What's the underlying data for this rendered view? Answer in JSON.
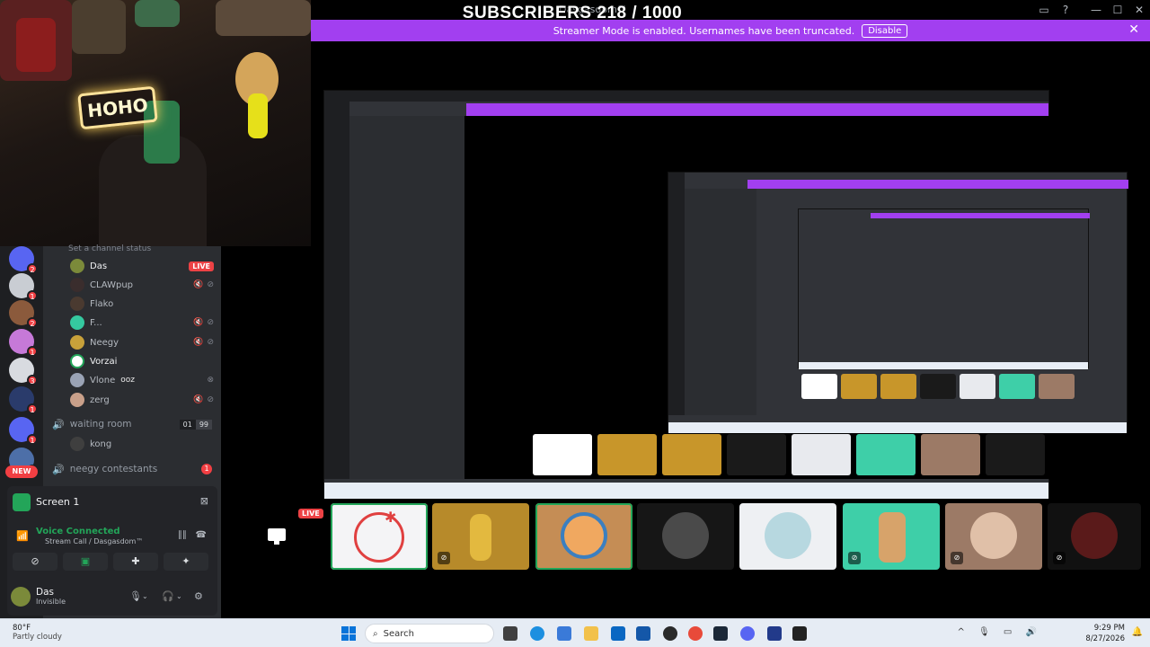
{
  "overlay": {
    "subscriber_counter": "SUBSCRIBERS 218 / 1000"
  },
  "window": {
    "title": "Dasgasdom™"
  },
  "streamer_banner": {
    "text": "Streamer Mode is enabled. Usernames have been truncated.",
    "button": "Disable"
  },
  "webcam": {
    "neon_text": "HOHO"
  },
  "sidebar": {
    "new_label": "NEW",
    "channel_status_hint": "Set a channel status",
    "server_badges": [
      "2",
      "1",
      "2",
      "1",
      "3",
      "1",
      "1",
      "1"
    ],
    "voice_users": [
      {
        "name": "Das",
        "badge": "LIVE"
      },
      {
        "name": "CLAWpup",
        "badge": ""
      },
      {
        "name": "Flako",
        "badge": ""
      },
      {
        "name": "F...",
        "badge": ""
      },
      {
        "name": "Neegy",
        "badge": ""
      },
      {
        "name": "Vorzai",
        "badge": ""
      },
      {
        "name": "Vlone",
        "badge": "ooz"
      },
      {
        "name": "zerg",
        "badge": ""
      }
    ],
    "waiting_room": {
      "name": "waiting room",
      "count": "01",
      "limit": "99",
      "member": "kong"
    },
    "neegy_contestants": {
      "name": "neegy contestants",
      "unread": "1"
    }
  },
  "voice_panel": {
    "screen_title": "Screen 1",
    "status": "Voice Connected",
    "channel": "Stream Call / Dasgasdom™",
    "user_name": "Das",
    "user_status": "Invisible"
  },
  "stage": {
    "live_label": "LIVE"
  },
  "taskbar": {
    "weather_temp": "80°F",
    "weather_cond": "Partly cloudy",
    "search_placeholder": "Search",
    "time": "9:29 PM",
    "date": "8/27/2026"
  },
  "colors": {
    "accent_purple": "#a23ff0",
    "discord_bg": "#2b2d31",
    "live_red": "#ed4245",
    "voice_green": "#23a559"
  }
}
